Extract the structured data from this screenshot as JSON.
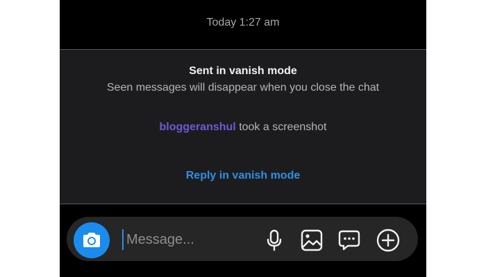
{
  "chat": {
    "timestamp": "Today 1:27 am"
  },
  "vanish": {
    "title": "Sent in vanish mode",
    "subtitle": "Seen messages will disappear when you close the chat",
    "screenshot_user": "bloggeranshul",
    "screenshot_text": "took a screenshot",
    "reply_label": "Reply in vanish mode"
  },
  "composer": {
    "placeholder": "Message...",
    "value": "",
    "icons": [
      "camera-icon",
      "microphone-icon",
      "gallery-icon",
      "sticker-icon",
      "plus-icon"
    ]
  },
  "colors": {
    "background": "#000000",
    "panel": "#1c1c1e",
    "username": "#6a5bd6",
    "link": "#2e90e6",
    "camera_button": "#1a8cf0"
  }
}
